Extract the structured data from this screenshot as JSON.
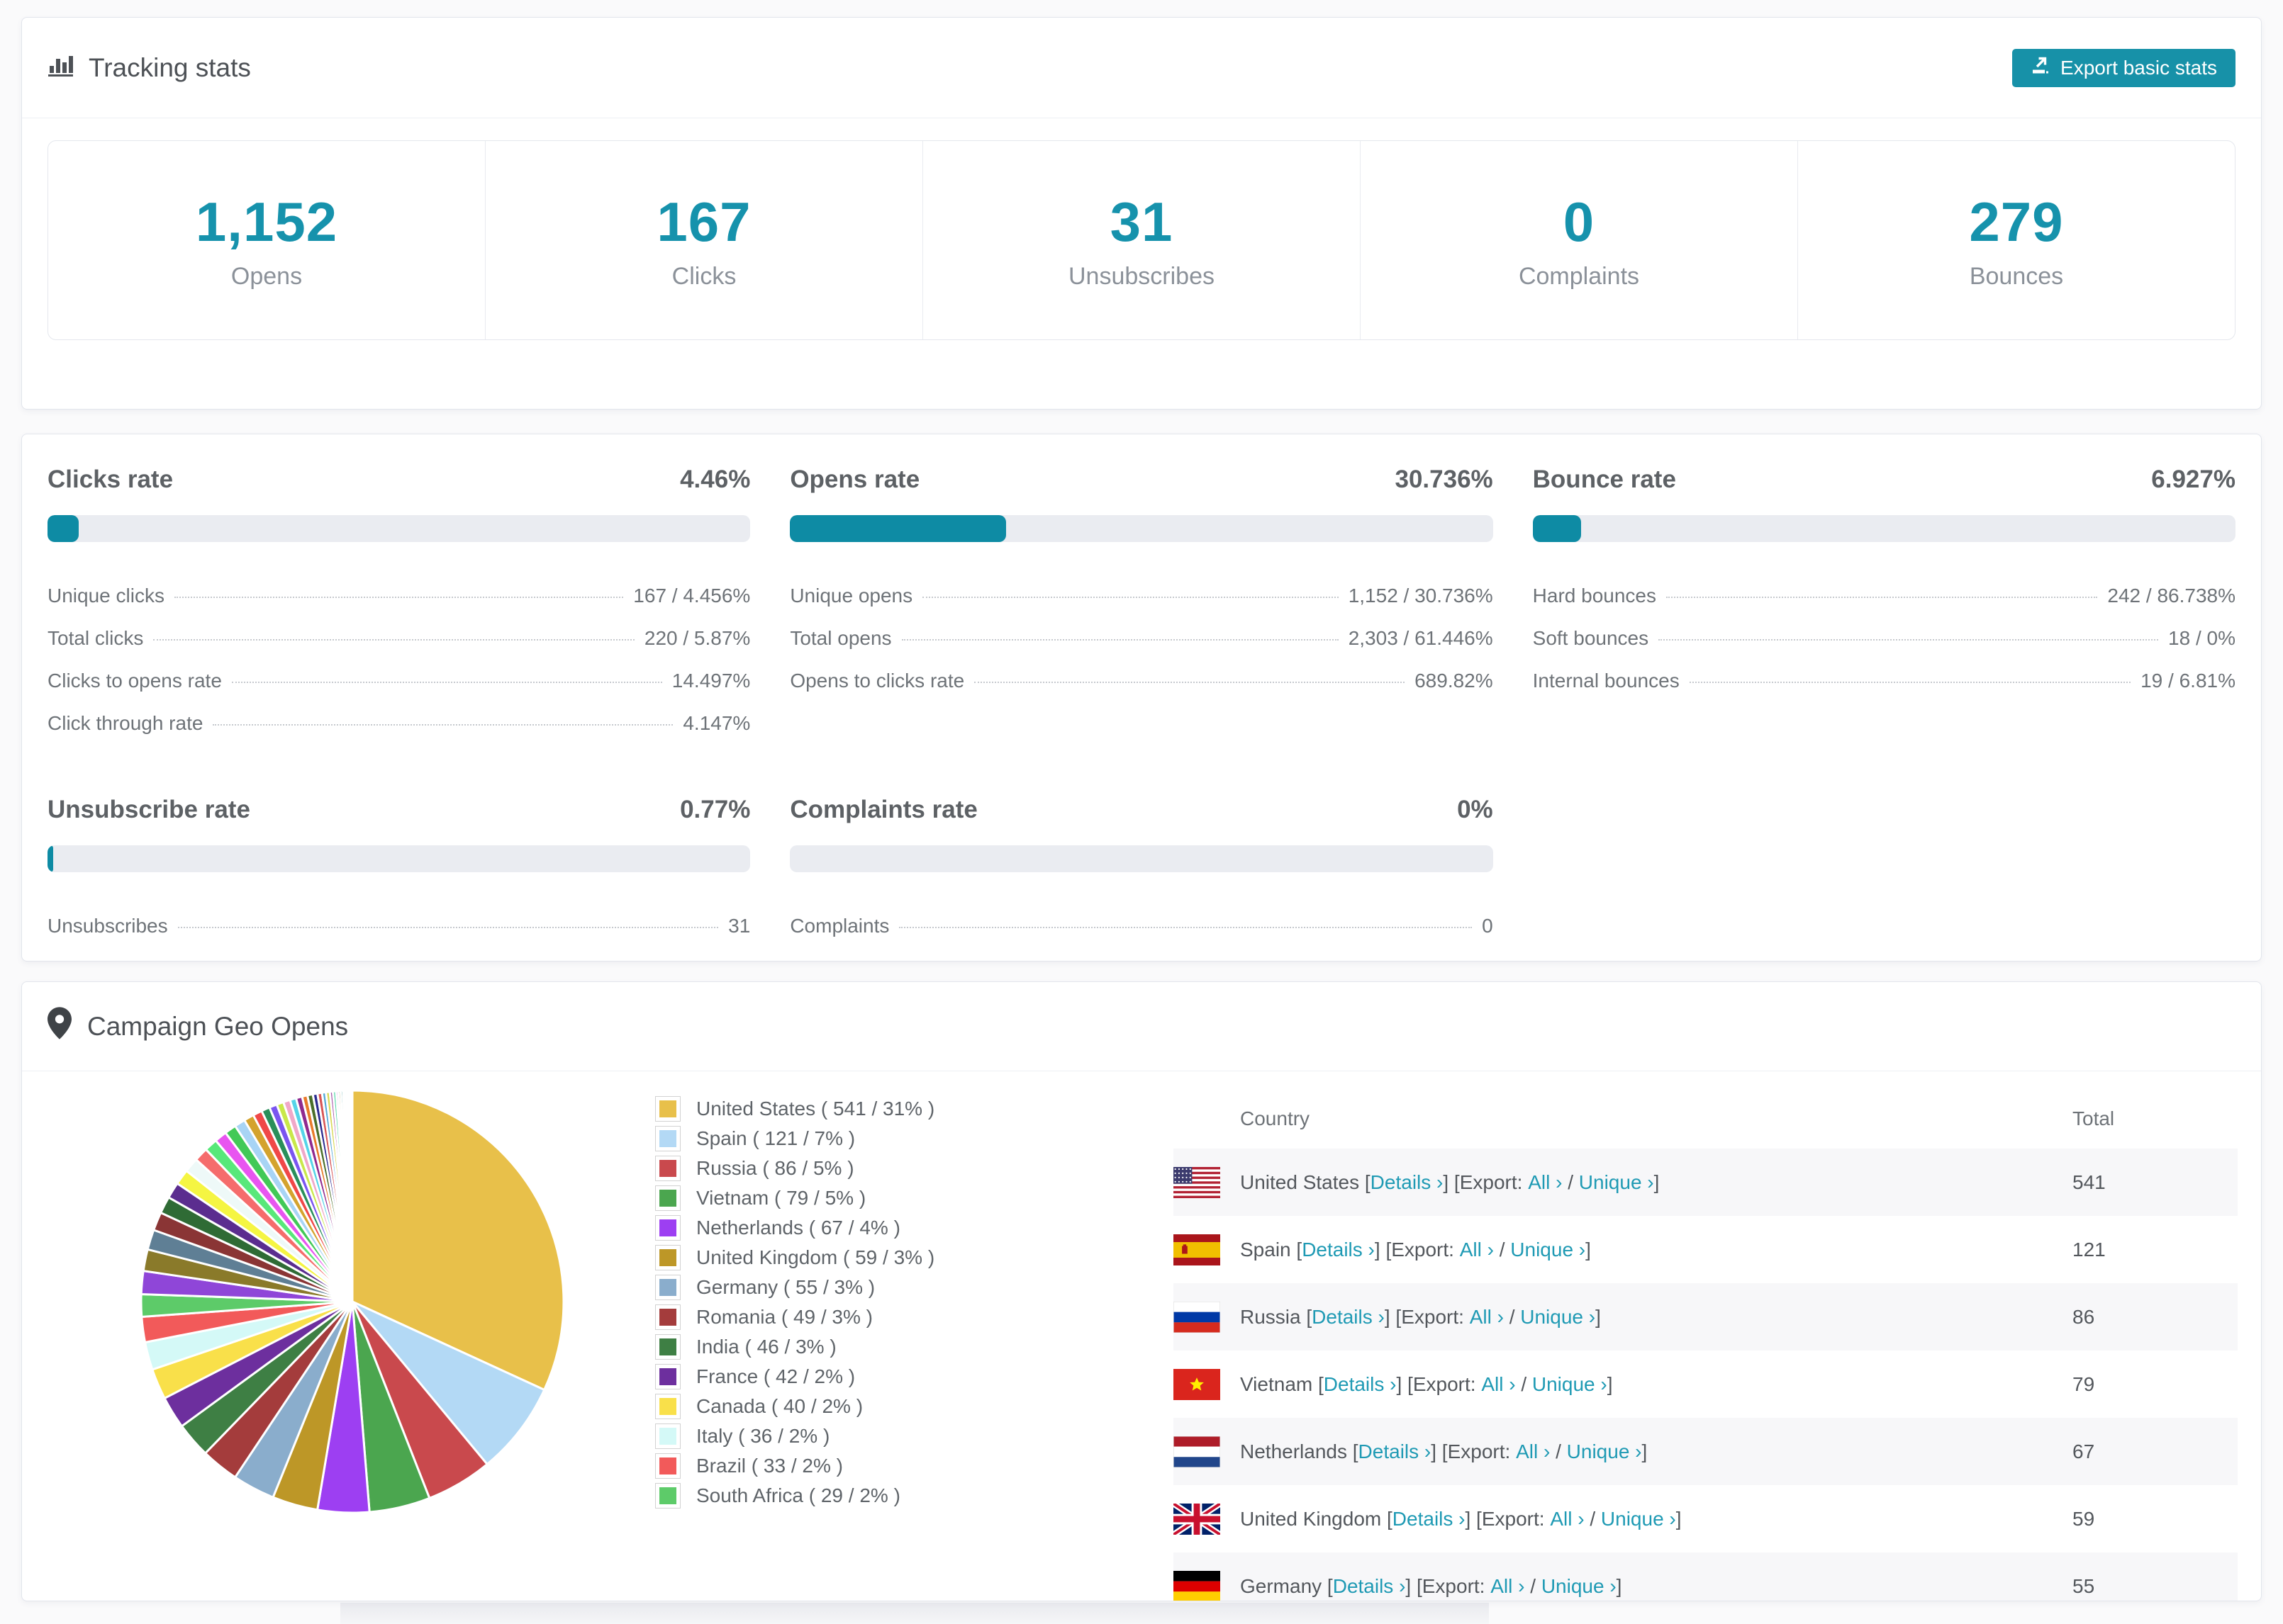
{
  "colors": {
    "accent": "#1692ac",
    "button": "#1791a8",
    "link": "#1f9ab4",
    "bar_fill": "#0e8ba4",
    "bar_track": "#eaecf1"
  },
  "tracking": {
    "title": "Tracking stats",
    "export_button": "Export basic stats",
    "summary": [
      {
        "value": "1,152",
        "label": "Opens"
      },
      {
        "value": "167",
        "label": "Clicks"
      },
      {
        "value": "31",
        "label": "Unsubscribes"
      },
      {
        "value": "0",
        "label": "Complaints"
      },
      {
        "value": "279",
        "label": "Bounces"
      }
    ]
  },
  "rates": {
    "blocks": [
      {
        "title": "Clicks rate",
        "value": "4.46%",
        "bar_pct": 4.46,
        "rows": [
          {
            "label": "Unique clicks",
            "value": "167 / 4.456%"
          },
          {
            "label": "Total clicks",
            "value": "220 / 5.87%"
          },
          {
            "label": "Clicks to opens rate",
            "value": "14.497%"
          },
          {
            "label": "Click through rate",
            "value": "4.147%"
          }
        ]
      },
      {
        "title": "Opens rate",
        "value": "30.736%",
        "bar_pct": 30.736,
        "rows": [
          {
            "label": "Unique opens",
            "value": "1,152 / 30.736%"
          },
          {
            "label": "Total opens",
            "value": "2,303 / 61.446%"
          },
          {
            "label": "Opens to clicks rate",
            "value": "689.82%"
          }
        ]
      },
      {
        "title": "Bounce rate",
        "value": "6.927%",
        "bar_pct": 6.927,
        "rows": [
          {
            "label": "Hard bounces",
            "value": "242 / 86.738%"
          },
          {
            "label": "Soft bounces",
            "value": "18 / 0%"
          },
          {
            "label": "Internal bounces",
            "value": "19 / 6.81%"
          }
        ]
      },
      {
        "title": "Unsubscribe rate",
        "value": "0.77%",
        "bar_pct": 0.77,
        "rows": [
          {
            "label": "Unsubscribes",
            "value": "31"
          }
        ]
      },
      {
        "title": "Complaints rate",
        "value": "0%",
        "bar_pct": 0,
        "rows": [
          {
            "label": "Complaints",
            "value": "0"
          }
        ]
      }
    ]
  },
  "geo": {
    "title": "Campaign Geo Opens",
    "table": {
      "columns": [
        "Country",
        "Total"
      ],
      "details_label": "Details ›",
      "export_label": "Export:",
      "all_label": "All ›",
      "unique_label": "Unique ›",
      "rows": [
        {
          "country": "United States",
          "flag": "us",
          "total": "541"
        },
        {
          "country": "Spain",
          "flag": "es",
          "total": "121"
        },
        {
          "country": "Russia",
          "flag": "ru",
          "total": "86"
        },
        {
          "country": "Vietnam",
          "flag": "vn",
          "total": "79"
        },
        {
          "country": "Netherlands",
          "flag": "nl",
          "total": "67"
        },
        {
          "country": "United Kingdom",
          "flag": "gb",
          "total": "59"
        },
        {
          "country": "Germany",
          "flag": "de",
          "total": "55"
        }
      ]
    }
  },
  "chart_data": {
    "type": "pie",
    "title": "Campaign Geo Opens",
    "legend_position": "right",
    "labels": [
      "United States",
      "Spain",
      "Russia",
      "Vietnam",
      "Netherlands",
      "United Kingdom",
      "Germany",
      "Romania",
      "India",
      "France",
      "Canada",
      "Italy",
      "Brazil",
      "South Africa"
    ],
    "values": [
      541,
      121,
      86,
      79,
      67,
      59,
      55,
      49,
      46,
      42,
      40,
      36,
      33,
      29
    ],
    "percents": [
      31,
      7,
      5,
      5,
      4,
      3,
      3,
      3,
      3,
      2,
      2,
      2,
      2,
      2
    ],
    "colors": [
      "#e8c04a",
      "#b3d9f5",
      "#c9494d",
      "#4ba64f",
      "#9d3ff2",
      "#bd9727",
      "#8aadcc",
      "#a43c3c",
      "#3e7f44",
      "#6d2f9e",
      "#f9e04a",
      "#d4f9f7",
      "#f25a5a",
      "#5dcb69"
    ],
    "others": [
      [
        30,
        "#8f46d8"
      ],
      [
        28,
        "#8a7a2a"
      ],
      [
        26,
        "#5f7f95"
      ],
      [
        24,
        "#8a3535"
      ],
      [
        22,
        "#2f6b35"
      ],
      [
        21,
        "#5b2d8f"
      ],
      [
        20,
        "#f5f542"
      ],
      [
        19,
        "#eef9f8"
      ],
      [
        18,
        "#f56c6c"
      ],
      [
        17,
        "#58e87a"
      ],
      [
        16,
        "#e855f0"
      ],
      [
        15,
        "#42c957"
      ],
      [
        14,
        "#a8d4f5"
      ],
      [
        13,
        "#d4a32e"
      ],
      [
        12,
        "#f04848"
      ],
      [
        11,
        "#2a8f5a"
      ],
      [
        10,
        "#7a55f0"
      ],
      [
        9,
        "#c9e84a"
      ],
      [
        9,
        "#f0a8c8"
      ],
      [
        8,
        "#55d4e8"
      ],
      [
        8,
        "#8f2a8f"
      ],
      [
        7,
        "#e87a2a"
      ],
      [
        7,
        "#4a6e2a"
      ],
      [
        6,
        "#2a2a8f"
      ],
      [
        6,
        "#d85555"
      ],
      [
        5,
        "#55a8d8"
      ],
      [
        5,
        "#d8d855"
      ],
      [
        4,
        "#a855a8"
      ],
      [
        4,
        "#55d8a8"
      ],
      [
        3,
        "#d855d8"
      ],
      [
        3,
        "#888f2a"
      ],
      [
        3,
        "#2a8f8f"
      ],
      [
        2,
        "#f5c26b"
      ],
      [
        2,
        "#6bb8f5"
      ],
      [
        2,
        "#b86bf5"
      ],
      [
        2,
        "#f56bb8"
      ],
      [
        1,
        "#6bf58a"
      ],
      [
        1,
        "#f5ef6b"
      ],
      [
        1,
        "#8a6b3a"
      ],
      [
        1,
        "#3a8a6b"
      ]
    ]
  }
}
